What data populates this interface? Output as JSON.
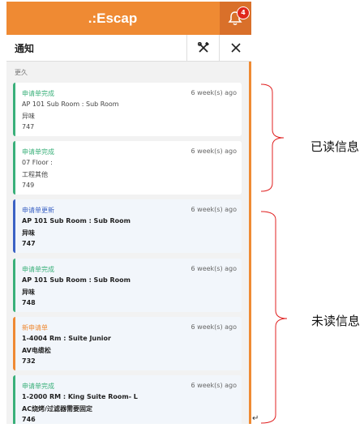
{
  "app": {
    "brand": ".:Escap",
    "badge_count": "4"
  },
  "panel": {
    "title": "通知"
  },
  "section_label": "更久",
  "notifications": [
    {
      "type": "申请单完成",
      "time": "6 week(s) ago",
      "location": "AP 101 Sub Room : Sub Room",
      "item": "异味",
      "id": "747",
      "status": "read",
      "color": "#3ab07a"
    },
    {
      "type": "申请单完成",
      "time": "6 week(s) ago",
      "location": "07 Floor :",
      "item": "工程其他",
      "id": "749",
      "status": "read",
      "color": "#3ab07a"
    },
    {
      "type": "申请单更新",
      "time": "6 week(s) ago",
      "location": "AP 101 Sub Room : Sub Room",
      "item": "异味",
      "id": "747",
      "status": "unread",
      "color": "#3b62c4"
    },
    {
      "type": "申请单完成",
      "time": "6 week(s) ago",
      "location": "AP 101 Sub Room : Sub Room",
      "item": "异味",
      "id": "748",
      "status": "unread",
      "color": "#3ab07a"
    },
    {
      "type": "新申请单",
      "time": "6 week(s) ago",
      "location": "1-4004 Rm : Suite Junior",
      "item": "AV电缆松",
      "id": "732",
      "status": "unread",
      "color": "#ef8a33"
    },
    {
      "type": "申请单完成",
      "time": "6 week(s) ago",
      "location": "1-2000 RM : King Suite Room- L",
      "item": "AC烧烤/过滤器需要固定",
      "id": "746",
      "status": "unread",
      "color": "#3ab07a"
    }
  ],
  "annotations": {
    "read_label": "已读信息",
    "unread_label": "未读信息"
  },
  "cursor_glyph": "↵",
  "colors": {
    "accent": "#ef8a33",
    "bracket": "#e02020",
    "badge": "#e0261b"
  }
}
